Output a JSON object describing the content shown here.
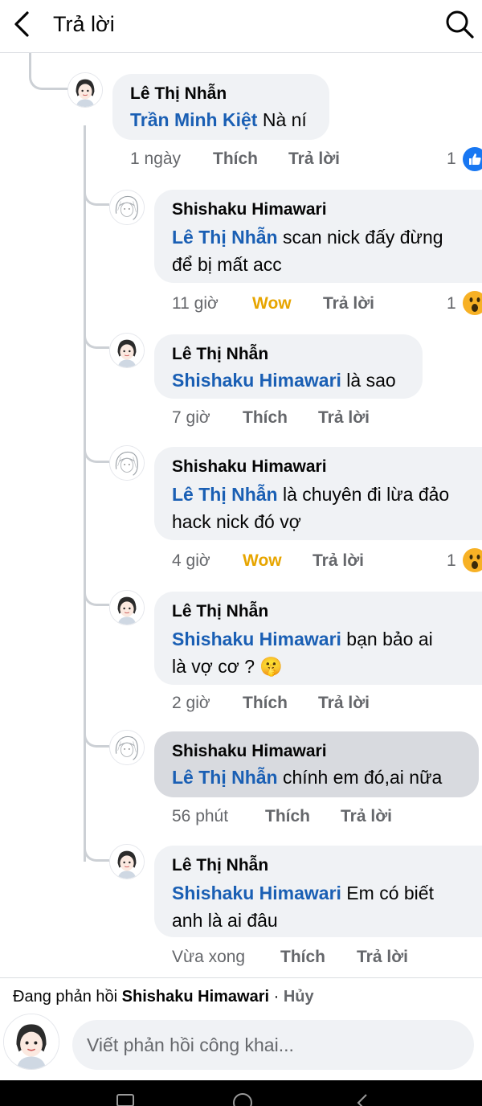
{
  "header": {
    "title": "Trả lời"
  },
  "comments": [
    {
      "author": "Lê Thị Nhẫn",
      "mention": "Trần Minh Kiệt",
      "text": " Nà ní",
      "time": "1 ngày",
      "reaction_label": "Thích",
      "reply_label": "Trả lời",
      "reaction_count": "1",
      "reaction_icon": "like-icon"
    },
    {
      "author": "Shishaku Himawari",
      "mention": "Lê Thị Nhẫn",
      "text": " scan nick đấy đừng để bị mất acc",
      "time": "11 giờ",
      "reaction_label": "Wow",
      "reply_label": "Trả lời",
      "reaction_count": "1",
      "reaction_icon": "wow-icon"
    },
    {
      "author": "Lê Thị Nhẫn",
      "mention": "Shishaku Himawari",
      "text": " là sao",
      "time": "7 giờ",
      "reaction_label": "Thích",
      "reply_label": "Trả lời"
    },
    {
      "author": "Shishaku Himawari",
      "mention": "Lê Thị Nhẫn",
      "text": " là chuyên đi lừa đảo hack nick đó vợ",
      "time": "4 giờ",
      "reaction_label": "Wow",
      "reply_label": "Trả lời",
      "reaction_count": "1",
      "reaction_icon": "wow-icon"
    },
    {
      "author": "Lê Thị Nhẫn",
      "mention": "Shishaku Himawari",
      "text": "  bạn bảo ai là vợ cơ ? 🤫",
      "time": "2 giờ",
      "reaction_label": "Thích",
      "reply_label": "Trả lời"
    },
    {
      "author": "Shishaku Himawari",
      "mention": "Lê Thị Nhẫn",
      "text": "  chính em đó,ai nữa",
      "time": "56 phút",
      "reaction_label": "Thích",
      "reply_label": "Trả lời"
    },
    {
      "author": "Lê Thị Nhẫn",
      "mention": "Shishaku Himawari",
      "text": " Em có biết anh là ai đâu",
      "time": "Vừa xong",
      "reaction_label": "Thích",
      "reply_label": "Trả lời"
    }
  ],
  "reply_box": {
    "replying_prefix": "Đang phản hồi ",
    "replying_to": "Shishaku Himawari",
    "separator": " · ",
    "cancel_label": "Hủy",
    "placeholder": "Viết phản hồi công khai..."
  },
  "colors": {
    "mention": "#1a5fb4",
    "wow": "#e7a500",
    "like": "#1877f2",
    "bubble": "#f0f2f5",
    "bubble_selected": "#d8dadf"
  }
}
